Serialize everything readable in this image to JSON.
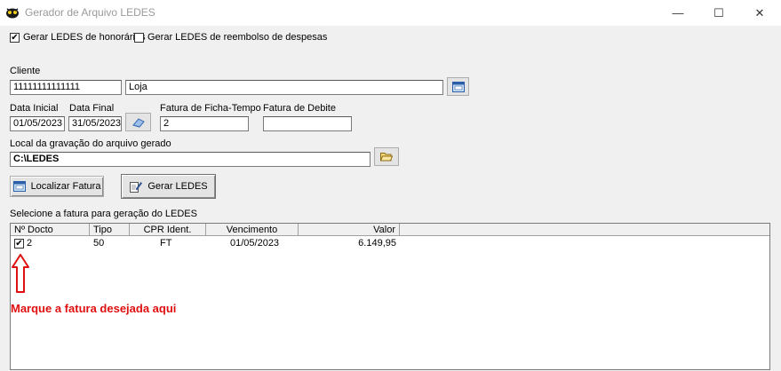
{
  "window": {
    "title": "Gerador de Arquivo LEDES",
    "minimize": "—",
    "maximize": "☐",
    "close": "✕"
  },
  "options": {
    "honorarios_label": "Gerar LEDES de honorários",
    "honorarios_checked": true,
    "reembolso_label": "Gerar LEDES de reembolso de despesas",
    "reembolso_checked": false
  },
  "cliente": {
    "label": "Cliente",
    "code": "11111111111111",
    "name": "Loja"
  },
  "dates": {
    "inicial_label": "Data Inicial",
    "inicial": "01/05/2023",
    "final_label": "Data Final",
    "final": "31/05/2023"
  },
  "fatura": {
    "ficha_label": "Fatura de Ficha-Tempo",
    "ficha": "2",
    "debite_label": "Fatura de Debite",
    "debite": ""
  },
  "local": {
    "label": "Local da gravação do arquivo gerado",
    "path": "C:\\LEDES"
  },
  "buttons": {
    "localizar": "Localizar Fatura",
    "gerar": "Gerar LEDES"
  },
  "list": {
    "caption": "Selecione a fatura para geração do LEDES",
    "headers": [
      "Nº Docto",
      "Tipo",
      "CPR Ident.",
      "Vencimento",
      "Valor"
    ],
    "rows": [
      {
        "docto": "2",
        "tipo": "50",
        "cpr": "FT",
        "vencimento": "01/05/2023",
        "valor": "6.149,95",
        "checked": true
      }
    ]
  },
  "annotation": {
    "text": "Marque a fatura desejada aqui",
    "color": "#e01010"
  }
}
